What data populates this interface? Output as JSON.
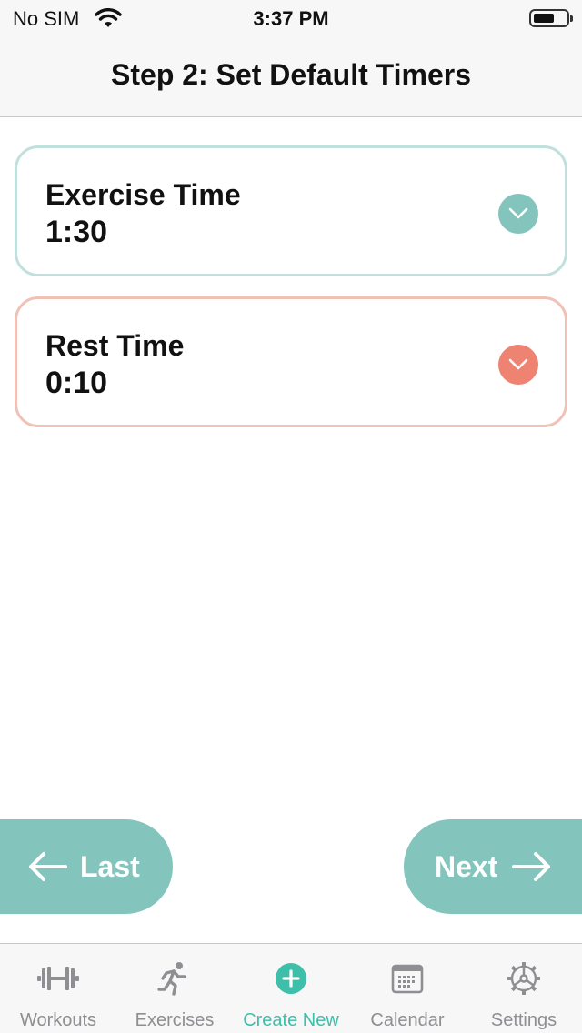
{
  "status_bar": {
    "carrier": "No SIM",
    "time": "3:37 PM"
  },
  "nav": {
    "title": "Step 2: Set Default Timers"
  },
  "timers": [
    {
      "label": "Exercise Time",
      "value": "1:30",
      "color": "#83c5bc",
      "border": "#bfe0dd"
    },
    {
      "label": "Rest Time",
      "value": "0:10",
      "color": "#ee8372",
      "border": "#f2c1b6"
    }
  ],
  "buttons": {
    "last_label": "Last",
    "next_label": "Next",
    "color": "#83c5bc"
  },
  "tabs": [
    {
      "label": "Workouts",
      "icon": "barbell-icon",
      "active": false
    },
    {
      "label": "Exercises",
      "icon": "running-figure-icon",
      "active": false
    },
    {
      "label": "Create New",
      "icon": "plus-circle-icon",
      "active": true
    },
    {
      "label": "Calendar",
      "icon": "calendar-icon",
      "active": false
    },
    {
      "label": "Settings",
      "icon": "gear-icon",
      "active": false
    }
  ],
  "colors": {
    "accent": "#3dbfaa",
    "inactive_tab": "#8e8e93"
  }
}
